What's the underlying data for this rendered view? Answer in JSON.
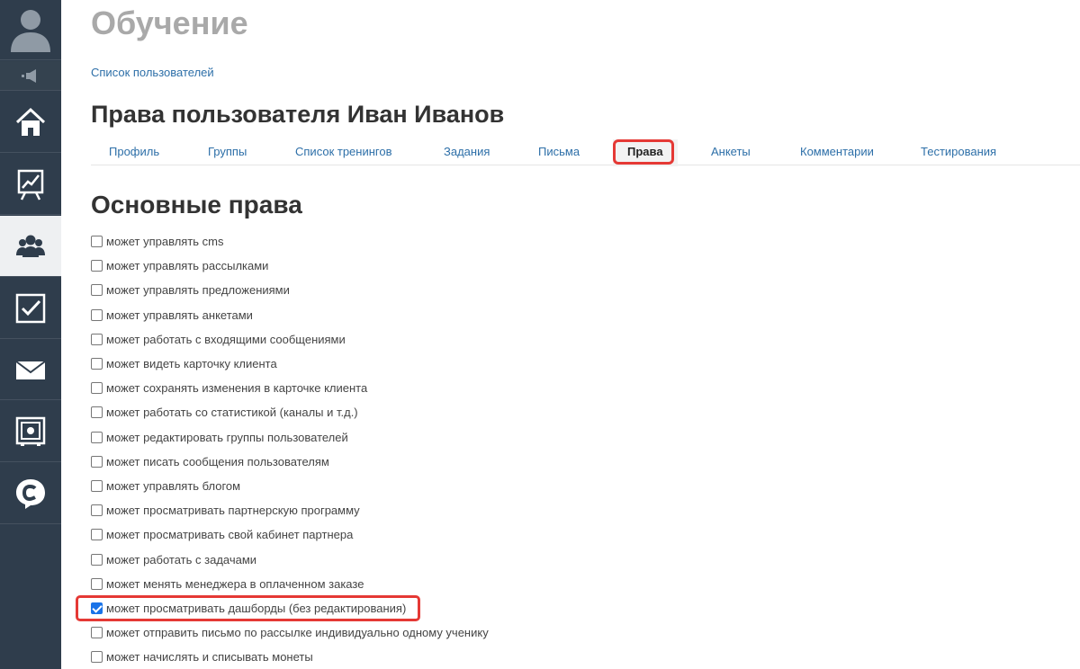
{
  "page_title": "Обучение",
  "breadcrumb": "Список пользователей",
  "user_title": "Права пользователя Иван Иванов",
  "tabs": [
    {
      "label": "Профиль",
      "active": false
    },
    {
      "label": "Группы",
      "active": false
    },
    {
      "label": "Список тренингов",
      "active": false
    },
    {
      "label": "Задания",
      "active": false
    },
    {
      "label": "Письма",
      "active": false
    },
    {
      "label": "Права",
      "active": true
    },
    {
      "label": "Анкеты",
      "active": false
    },
    {
      "label": "Комментарии",
      "active": false
    },
    {
      "label": "Тестирования",
      "active": false
    }
  ],
  "section_title": "Основные права",
  "permissions": [
    {
      "label": "может управлять cms",
      "checked": false
    },
    {
      "label": "может управлять рассылками",
      "checked": false
    },
    {
      "label": "может управлять предложениями",
      "checked": false
    },
    {
      "label": "может управлять анкетами",
      "checked": false
    },
    {
      "label": "может работать с входящими сообщениями",
      "checked": false
    },
    {
      "label": "может видеть карточку клиента",
      "checked": false
    },
    {
      "label": "может сохранять изменения в карточке клиента",
      "checked": false
    },
    {
      "label": "может работать со статистикой (каналы и т.д.)",
      "checked": false
    },
    {
      "label": "может редактировать группы пользователей",
      "checked": false
    },
    {
      "label": "может писать сообщения пользователям",
      "checked": false
    },
    {
      "label": "может управлять блогом",
      "checked": false
    },
    {
      "label": "может просматривать партнерскую программу",
      "checked": false
    },
    {
      "label": "может просматривать свой кабинет партнера",
      "checked": false
    },
    {
      "label": "может работать с задачами",
      "checked": false
    },
    {
      "label": "может менять менеджера в оплаченном заказе",
      "checked": false
    },
    {
      "label": "может просматривать дашборды (без редактирования)",
      "checked": true
    },
    {
      "label": "может отправить письмо по рассылке индивидуально одному ученику",
      "checked": false
    },
    {
      "label": "может начислять и списывать монеты",
      "checked": false
    }
  ],
  "sidebar": {
    "items": [
      {
        "icon": "home-icon",
        "active": false
      },
      {
        "icon": "presentation-chart-icon",
        "active": false
      },
      {
        "icon": "users-icon",
        "active": true
      },
      {
        "icon": "checkbox-task-icon",
        "active": false
      },
      {
        "icon": "envelope-icon",
        "active": false
      },
      {
        "icon": "safe-icon",
        "active": false
      },
      {
        "icon": "chat-logo-icon",
        "active": false
      }
    ]
  },
  "colors": {
    "sidebar_bg": "#2f3d4c",
    "link": "#2d6fa8",
    "highlight": "#e53935",
    "checkbox_checked": "#1a73e8"
  }
}
